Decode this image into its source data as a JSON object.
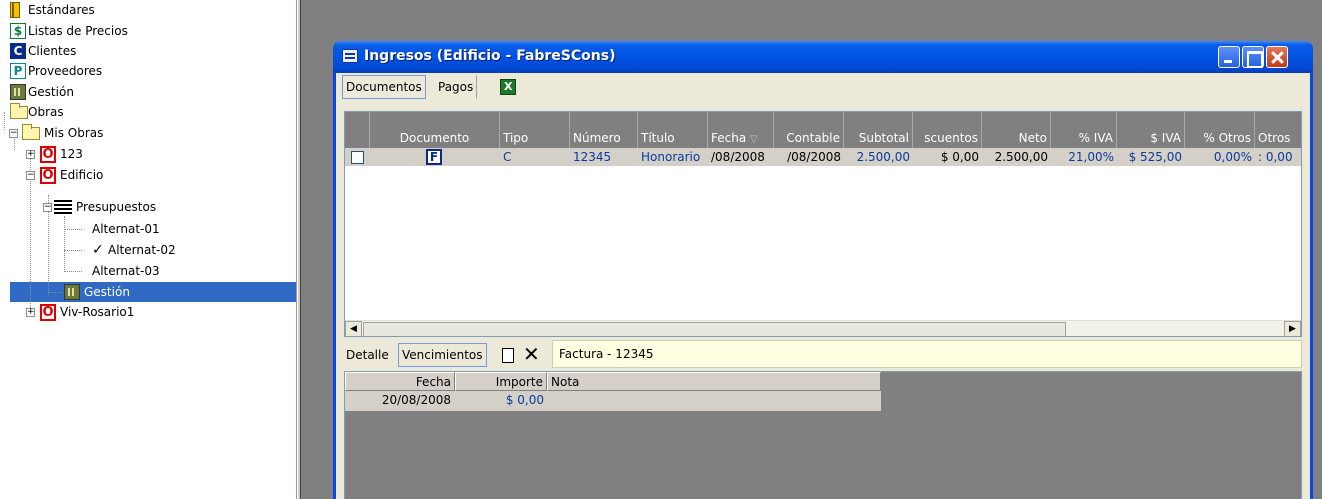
{
  "tree": {
    "items": [
      {
        "label": "Estándares"
      },
      {
        "label": "Listas de Precios"
      },
      {
        "label": "Clientes"
      },
      {
        "label": "Proveedores"
      },
      {
        "label": "Gestión"
      },
      {
        "label": "Obras"
      },
      {
        "label": "Mis Obras"
      },
      {
        "label": "123"
      },
      {
        "label": "Edificio"
      },
      {
        "label": "Presupuestos"
      },
      {
        "label": "Alternat-01"
      },
      {
        "label": "Alternat-02"
      },
      {
        "label": "Alternat-03"
      },
      {
        "label": "Gestión"
      },
      {
        "label": "Viv-Rosario1"
      }
    ],
    "icon_letters": {
      "listas": "$",
      "clientes": "C",
      "proveedores": "P",
      "obra": "O"
    },
    "check_mark": "✓",
    "selected_item": "Gestión",
    "expanders": {
      "minus": "−",
      "plus": "+"
    }
  },
  "window": {
    "title": "Ingresos (Edificio - FabreSCons)",
    "accent": "#0054e3"
  },
  "tabs": {
    "documentos": "Documentos",
    "pagos": "Pagos"
  },
  "grid": {
    "columns": [
      "Documento",
      "Tipo",
      "Número",
      "Título",
      "Fecha",
      "Contable",
      "Subtotal",
      "scuentos",
      "Neto",
      "% IVA",
      "$ IVA",
      "% Otros",
      "Otros"
    ],
    "sort_indicator": "▽",
    "rows": [
      {
        "doc_letter": "F",
        "tipo": "C",
        "numero": "12345",
        "titulo": "Honorario",
        "fecha": "/08/2008",
        "contable": "/08/2008",
        "subtotal": "2.500,00",
        "descuentos": "$ 0,00",
        "neto": "2.500,00",
        "pct_iva": "21,00%",
        "iva": "$ 525,00",
        "pct_otros": "0,00%",
        "otros": ": 0,00"
      }
    ],
    "scroll_left": "◀",
    "scroll_right": "▶"
  },
  "bottom": {
    "tab_detalle": "Detalle",
    "tab_vencimientos": "Vencimientos",
    "delete_glyph": "✕",
    "info": "Factura - 12345",
    "columns": [
      "Fecha",
      "Importe",
      "Nota"
    ],
    "rows": [
      {
        "fecha": "20/08/2008",
        "importe": "$ 0,00",
        "nota": ""
      }
    ]
  }
}
